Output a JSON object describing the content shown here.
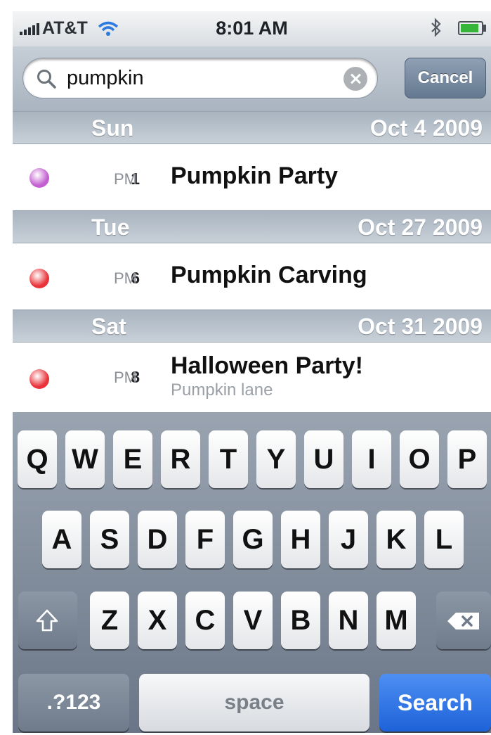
{
  "status_bar": {
    "carrier": "AT&T",
    "time": "8:01 AM",
    "battery_level": 0.9
  },
  "search": {
    "query": "pumpkin",
    "cancel_label": "Cancel"
  },
  "results": [
    {
      "day": "Sun",
      "date": "Oct 4 2009",
      "event": {
        "hour": "1",
        "ampm": "PM",
        "title": "Pumpkin Party",
        "location": "",
        "color": "#c35fd0"
      }
    },
    {
      "day": "Tue",
      "date": "Oct 27 2009",
      "event": {
        "hour": "6",
        "ampm": "PM",
        "title": "Pumpkin Carving",
        "location": "",
        "color": "#e8333a"
      }
    },
    {
      "day": "Sat",
      "date": "Oct 31 2009",
      "event": {
        "hour": "8",
        "ampm": "PM",
        "title": "Halloween Party!",
        "location": "Pumpkin lane",
        "color": "#e8333a"
      }
    }
  ],
  "keyboard": {
    "row1": [
      "Q",
      "W",
      "E",
      "R",
      "T",
      "Y",
      "U",
      "I",
      "O",
      "P"
    ],
    "row2": [
      "A",
      "S",
      "D",
      "F",
      "G",
      "H",
      "J",
      "K",
      "L"
    ],
    "row3": [
      "Z",
      "X",
      "C",
      "V",
      "B",
      "N",
      "M"
    ],
    "numbers_label": ".?123",
    "space_label": "space",
    "search_label": "Search"
  },
  "colors": {
    "search_key": "#2c70e4",
    "purple_calendar": "#c35fd0",
    "red_calendar": "#e8333a"
  }
}
